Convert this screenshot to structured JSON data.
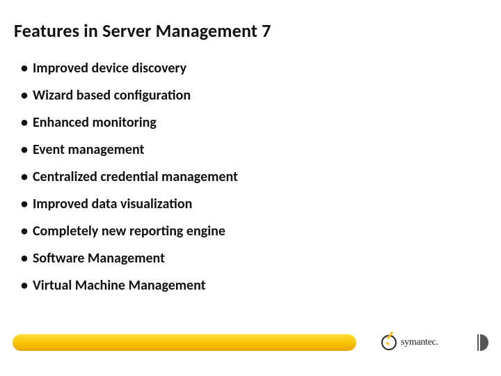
{
  "title": "Features in Server Management 7",
  "bullets": [
    "Improved device discovery",
    "Wizard based configuration",
    "Enhanced monitoring",
    "Event management",
    "Centralized credential management",
    "Improved data visualization",
    "Completely new reporting engine",
    "Software Management",
    "Virtual Machine Management"
  ],
  "brand": "symantec."
}
